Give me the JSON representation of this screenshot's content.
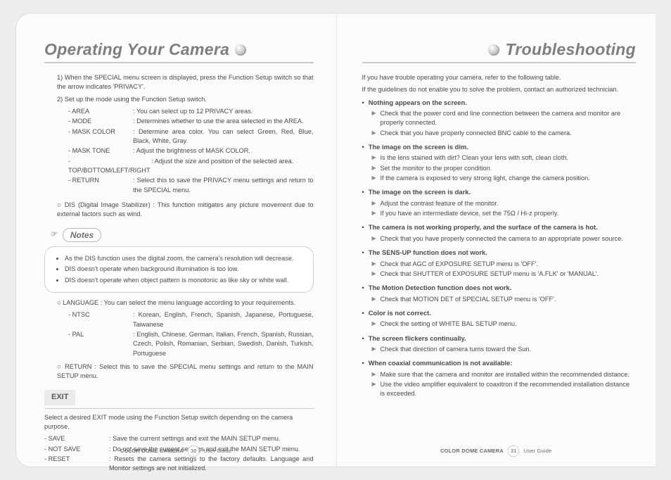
{
  "left": {
    "heading": "Operating Your Camera",
    "intro_1": "1) When the SPECIAL menu screen is displayed, press the Function Setup switch so that the arrow indicates 'PRIVACY'.",
    "intro_2": "2) Set up the mode using the Function Setup switch.",
    "privacy_rows": [
      {
        "label": "- AREA",
        "desc": ": You can select up to 12 PRIVACY areas."
      },
      {
        "label": "- MODE",
        "desc": ": Determines whether to use the area selected in the AREA."
      },
      {
        "label": "- MASK COLOR",
        "desc": ": Determine area color. You can select Green, Red, Blue, Black, White, Gray."
      },
      {
        "label": "- MASK TONE",
        "desc": ": Adjust the brightness of MASK COLOR."
      },
      {
        "label": "- TOP/BOTTOM/LEFT/RIGHT",
        "label_wide": true,
        "desc": ":  Adjust the size and position of the selected area."
      },
      {
        "label": "- RETURN",
        "desc": ": Select this to save the PRIVACY menu settings and return to the SPECIAL menu."
      }
    ],
    "dis_prefix": "○ DIS (Digital Image Stabilizer) :",
    "dis_desc": " This function mitigates any picture movement due to external factors such as wind.",
    "notes_title": "Notes",
    "notes": [
      "As the DIS function uses the digital zoom, the camera's resolution will decrease.",
      "DIS doesn't operate when background illumination is too low.",
      "DIS doesn't operate when object pattern is monotonic as like sky or white wall."
    ],
    "language_line": "○ LANGUAGE : You can select the menu language according to your requirements.",
    "lang_rows": [
      {
        "label": "- NTSC",
        "desc": ": Korean, English, French, Spanish, Japanese, Portuguese, Taiwanese"
      },
      {
        "label": "- PAL",
        "desc": ": English, Chinese, German, Italian, French, Spanish, Russian, Czech, Polish, Romanian, Serbian, Swedish, Danish, Turkish, Portuguese"
      }
    ],
    "return_line": "○ RETURN : Select this to save the SPECIAL menu settings and return to the MAIN SETUP menu.",
    "exit_label": "EXIT",
    "exit_intro": "Select a desired EXIT mode using the Function Setup switch depending on the camera purpose.",
    "exit_rows": [
      {
        "label": "- SAVE",
        "desc": ": Save the current settings and exit the MAIN SETUP menu."
      },
      {
        "label": "- NOT SAVE",
        "desc": ": Do not save the current settings and exit the MAIN SETUP menu."
      },
      {
        "label": "- RESET",
        "desc": ": Resets the camera settings to the factory defaults. Language and Monitor settings are not initialized."
      }
    ]
  },
  "right": {
    "heading": "Troubleshooting",
    "intro_1": "If you have trouble operating your camera, refer to the following table.",
    "intro_2": "If the guidelines do not enable you to solve the problem, contact an authorized technician.",
    "items": [
      {
        "h": "Nothing appears on the screen.",
        "points": [
          "Check that the power cord and line connection between the camera and monitor are properly connected.",
          "Check that you have properly connected BNC cable to the camera."
        ]
      },
      {
        "h": "The image on the screen is dim.",
        "points": [
          "Is the lens stained with dirt? Clean your lens with soft, clean cloth.",
          "Set the monitor to the proper condition.",
          "If the camera is exposed to very strong light, change the camera position."
        ]
      },
      {
        "h": "The image on the screen is dark.",
        "points": [
          "Adjust the contrast feature of the monitor.",
          "If you have an intermediate device, set the 75Ω / Hi-z properly."
        ]
      },
      {
        "h": "The camera is not working properly, and the surface of the camera is hot.",
        "points": [
          "Check that you have properly connected the camera to an appropriate power source."
        ]
      },
      {
        "h": "The SENS-UP function does not work.",
        "points": [
          "Check that AGC of EXPOSURE SETUP menu is 'OFF'.",
          "Check that SHUTTER of EXPOSURE SETUP menu is 'A.FLK' or 'MANUAL'."
        ]
      },
      {
        "h": "The Motion Detection function does not work.",
        "points": [
          "Check that MOTION DET of SPECIAL SETUP menu is 'OFF'."
        ]
      },
      {
        "h": "Color is not correct.",
        "points": [
          "Check the setting of WHITE BAL SETUP menu."
        ]
      },
      {
        "h": "The screen flickers continually.",
        "points": [
          "Check that direction of camera turns toward the Sun."
        ]
      },
      {
        "h": "When coaxial communication is not available:",
        "points": [
          "Make sure that the camera and monitor are installed within the recommended distance.",
          "Use the video amplifier equivalent to coaxitron if the recommended installation distance is exceeded."
        ]
      }
    ]
  },
  "footer": {
    "product": "COLOR DOME CAMERA",
    "guide": "User Guide",
    "page_left": "30",
    "page_right": "31"
  }
}
